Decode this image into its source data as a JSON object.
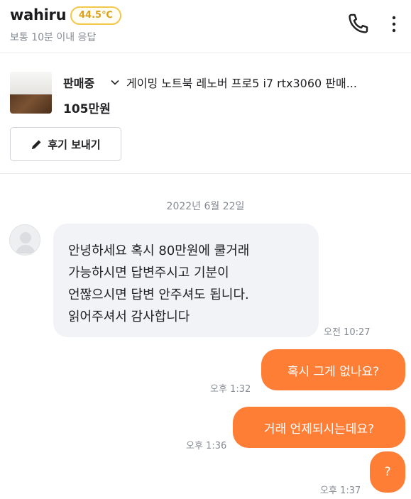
{
  "header": {
    "username": "wahiru",
    "temperature": "44.5℃",
    "response_time": "보통 10분 이내 응답",
    "icons": [
      "phone-icon",
      "more-vertical-icon"
    ]
  },
  "product": {
    "status": "판매중",
    "title": "게이밍 노트북 레노버 프로5 i7 rtx3060 판매...",
    "price": "105만원",
    "review_button": "후기 보내기"
  },
  "chat": {
    "date": "2022년 6월 22일",
    "incoming": {
      "lines": [
        "안녕하세요 혹시 80만원에 쿨거래",
        "가능하시면 답변주시고 기분이",
        "언짢으시면 답변 안주셔도 됩니다.",
        "읽어주셔서 감사합니다"
      ],
      "time": "오전 10:27"
    },
    "outgoing": [
      {
        "text": "혹시 그게 없나요?",
        "time": "오후 1:32"
      },
      {
        "text": "거래 언제되시는데요?",
        "time": "오후 1:36"
      },
      {
        "text": "?",
        "time": "오후 1:37"
      }
    ]
  },
  "colors": {
    "accent": "#ff7e36",
    "badge_border": "#f3c74a",
    "badge_text": "#d9a21a",
    "incoming_bubble": "#f2f3f6",
    "muted_text": "#868b94"
  }
}
